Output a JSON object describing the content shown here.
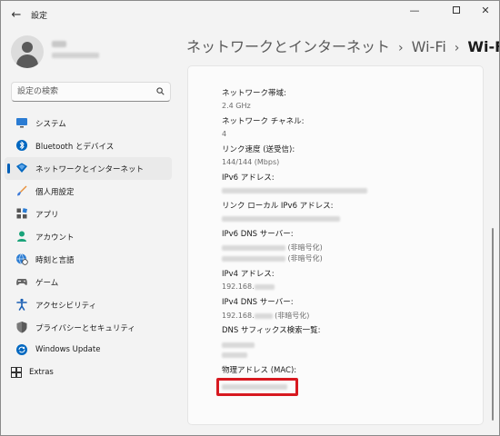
{
  "app": {
    "title": "設定"
  },
  "search": {
    "placeholder": "設定の検索"
  },
  "sidebar": {
    "items": [
      {
        "label": "システム"
      },
      {
        "label": "Bluetooth とデバイス"
      },
      {
        "label": "ネットワークとインターネット",
        "selected": true
      },
      {
        "label": "個人用設定"
      },
      {
        "label": "アプリ"
      },
      {
        "label": "アカウント"
      },
      {
        "label": "時刻と言語"
      },
      {
        "label": "ゲーム"
      },
      {
        "label": "アクセシビリティ"
      },
      {
        "label": "プライバシーとセキュリティ"
      },
      {
        "label": "Windows Update"
      },
      {
        "label": "Extras"
      }
    ]
  },
  "header": {
    "breadcrumb": [
      "ネットワークとインターネット",
      "Wi-Fi"
    ],
    "current": "Wi-Fi"
  },
  "properties": [
    {
      "label": "ネットワーク帯域:",
      "values": [
        "2.4 GHz"
      ]
    },
    {
      "label": "ネットワーク チャネル:",
      "values": [
        "4"
      ]
    },
    {
      "label": "リンク速度 (送受信):",
      "values": [
        "144/144 (Mbps)"
      ]
    },
    {
      "label": "IPv6 アドレス:",
      "values": []
    },
    {
      "label": "リンク ローカル IPv6 アドレス:",
      "values": []
    },
    {
      "label": "IPv6 DNS サーバー:",
      "values": [
        "(非暗号化)",
        "(非暗号化)"
      ]
    },
    {
      "label": "IPv4 アドレス:",
      "values": [
        "192.168."
      ]
    },
    {
      "label": "IPv4 DNS サーバー:",
      "values": [
        "192.168.",
        "(非暗号化)"
      ]
    },
    {
      "label": "DNS サフィックス検索一覧:",
      "values": []
    },
    {
      "label": "物理アドレス (MAC):",
      "values": []
    }
  ],
  "colors": {
    "accent": "#005fb8",
    "highlight_box": "#d71920"
  }
}
